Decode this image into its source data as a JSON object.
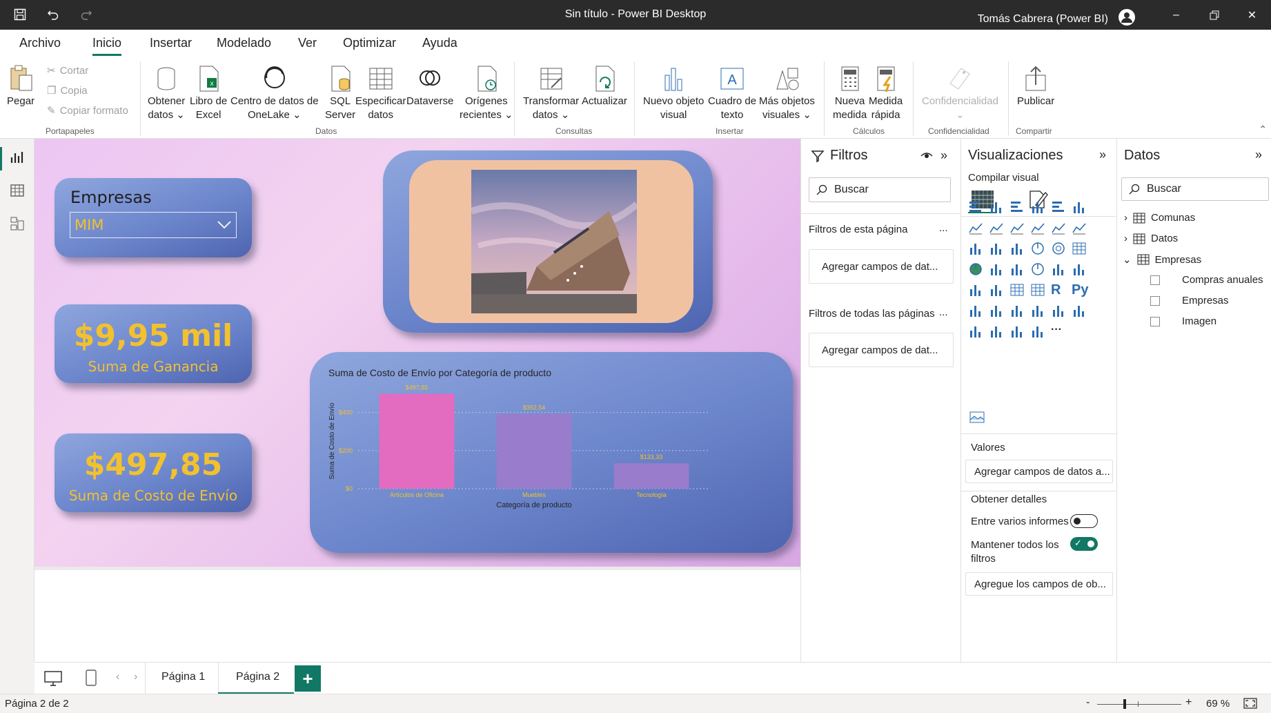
{
  "window": {
    "title": "Sin título - Power BI Desktop",
    "user": "Tomás Cabrera (Power BI)"
  },
  "menu": {
    "tabs": [
      "Archivo",
      "Inicio",
      "Insertar",
      "Modelado",
      "Ver",
      "Optimizar",
      "Ayuda"
    ],
    "active": "Inicio"
  },
  "ribbon": {
    "paste": "Pegar",
    "cut": "Cortar",
    "copy": "Copia",
    "format_painter": "Copiar formato",
    "groups": {
      "clipboard": "Portapapeles",
      "data": "Datos",
      "queries": "Consultas",
      "insert": "Insertar",
      "calculations": "Cálculos",
      "sensitivity": "Confidencialidad",
      "share": "Compartir"
    },
    "buttons": {
      "get_data_1": "Obtener",
      "get_data_2": "datos",
      "excel_1": "Libro de",
      "excel_2": "Excel",
      "onelake_1": "Centro de datos de",
      "onelake_2": "OneLake",
      "sql_1": "SQL",
      "sql_2": "Server",
      "enter_data_1": "Especificar",
      "enter_data_2": "datos",
      "dataverse": "Dataverse",
      "recent_1": "Orígenes",
      "recent_2": "recientes",
      "transform_1": "Transformar",
      "transform_2": "datos",
      "refresh": "Actualizar",
      "new_visual_1": "Nuevo objeto",
      "new_visual_2": "visual",
      "textbox_1": "Cuadro de",
      "textbox_2": "texto",
      "more_visuals_1": "Más objetos",
      "more_visuals_2": "visuales",
      "new_measure_1": "Nueva",
      "new_measure_2": "medida",
      "quick_measure_1": "Medida",
      "quick_measure_2": "rápida",
      "sensitivity": "Confidencialidad",
      "publish": "Publicar"
    }
  },
  "report": {
    "slicer": {
      "title": "Empresas",
      "selected": "MIM"
    },
    "kpi1": {
      "value": "$9,95 mil",
      "label": "Suma de Ganancia"
    },
    "kpi2": {
      "value": "$497,85",
      "label": "Suma de Costo de Envío"
    }
  },
  "chart_data": {
    "type": "bar",
    "title": "Suma de Costo de Envío por Categoría de producto",
    "xlabel": "Categoría de producto",
    "ylabel": "Suma de Costo de Envío",
    "categories": [
      "Artículos de Oficina",
      "Muebles",
      "Tecnología"
    ],
    "values": [
      497.85,
      392.54,
      133.33
    ],
    "value_labels": [
      "$497,85",
      "$392,54",
      "$133,33"
    ],
    "yticks": [
      "$0",
      "$200",
      "$400"
    ],
    "ylim": [
      0,
      500
    ],
    "colors": {
      "highlight": "#e36cc0",
      "normal": "#9a7ccc",
      "label": "#f2c12e"
    }
  },
  "filters": {
    "title": "Filtros",
    "search_placeholder": "Buscar",
    "page_filters": "Filtros de esta página",
    "all_pages_filters": "Filtros de todas las páginas",
    "add_fields": "Agregar campos de dat...",
    "more": "..."
  },
  "visualizations": {
    "title": "Visualizaciones",
    "build_visual": "Compilar visual",
    "values": "Valores",
    "values_well": "Agregar campos de datos a...",
    "drillthrough": "Obtener detalles",
    "cross_report": "Entre varios informes",
    "keep_filters_1": "Mantener todos los",
    "keep_filters_2": "filtros",
    "drill_well": "Agregue los campos de ob...",
    "r_label": "R",
    "py_label": "Py",
    "more_label": "···"
  },
  "data": {
    "title": "Datos",
    "search_placeholder": "Buscar",
    "tables": [
      "Comunas",
      "Datos",
      "Empresas"
    ],
    "fields": [
      "Compras anuales",
      "Empresas",
      "Imagen"
    ]
  },
  "pages": {
    "tabs": [
      "Página 1",
      "Página 2"
    ],
    "active": "Página 2",
    "add": "+"
  },
  "status": {
    "page": "Página 2 de 2",
    "zoom": "69 %",
    "minus": "-",
    "plus": "+"
  }
}
